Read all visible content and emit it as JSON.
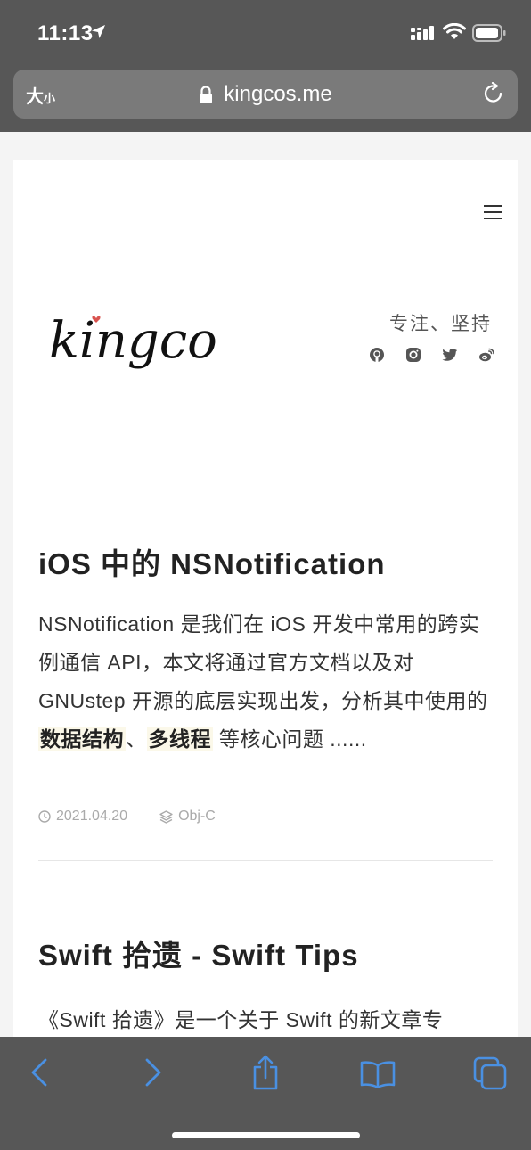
{
  "status_bar": {
    "time": "11:13"
  },
  "address_bar": {
    "text_size_label": "大",
    "text_size_small": "小",
    "url": "kingcos.me"
  },
  "site": {
    "logo_text": "kingcos",
    "tagline": "专注、坚持"
  },
  "posts": [
    {
      "title": "iOS 中的 NSNotification",
      "excerpt_part1": "NSNotification 是我们在 iOS 开发中常用的跨实例通信 API，本文将通过官方文档以及对 GNUstep 开源的底层实现出发，分析其中使用的",
      "highlight1": "数据结构",
      "sep": "、",
      "highlight2": "多线程",
      "excerpt_part2": "等核心问题 ......",
      "date": "2021.04.20",
      "category": "Obj-C"
    },
    {
      "title": "Swift 拾遗 - Swift Tips",
      "excerpt": "《Swift 拾遗》是一个关于 Swift 的新文章专"
    }
  ],
  "colors": {
    "chrome": "#575757",
    "address_bar": "#7a7a7a",
    "toolbar_icon": "#4a90e2",
    "highlight_bg": "#fbf8e9"
  }
}
